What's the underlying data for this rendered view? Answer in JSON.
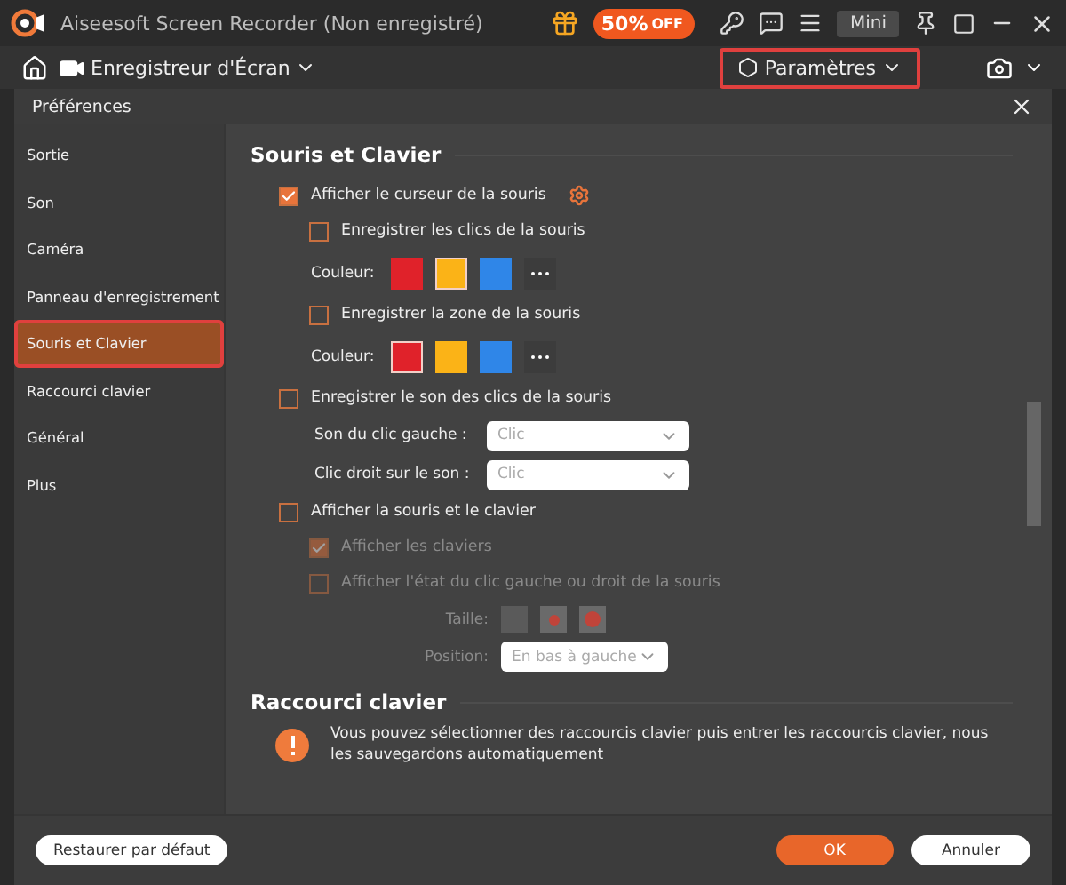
{
  "title_bar": {
    "title": "Aiseesoft Screen Recorder (Non enregistré)",
    "promo": {
      "amount": "50%",
      "suffix": "OFF"
    },
    "mini_button": "Mini"
  },
  "toolbar": {
    "mode": "Enregistreur d'Écran",
    "settings": {
      "label": "Paramètres",
      "highlighted": true
    }
  },
  "dialog": {
    "title": "Préférences",
    "sidebar": [
      {
        "label": "Sortie",
        "selected": false,
        "highlighted": false
      },
      {
        "label": "Son",
        "selected": false,
        "highlighted": false
      },
      {
        "label": "Caméra",
        "selected": false,
        "highlighted": false
      },
      {
        "label": "Panneau d'enregistrement",
        "selected": false,
        "highlighted": false
      },
      {
        "label": "Souris et Clavier",
        "selected": true,
        "highlighted": true
      },
      {
        "label": "Raccourci clavier",
        "selected": false,
        "highlighted": false
      },
      {
        "label": "Général",
        "selected": false,
        "highlighted": false
      },
      {
        "label": "Plus",
        "selected": false,
        "highlighted": false
      }
    ],
    "sections": [
      {
        "title": "Souris et Clavier",
        "options": [
          {
            "label": "Afficher le curseur de la souris",
            "checked": true,
            "disabled": false,
            "settings": true,
            "children": [
              {
                "label": "Enregistrer les clics de la souris",
                "checked": false,
                "disabled": false,
                "colors": {
                  "label": "Couleur:",
                  "swatches": [
                    {
                      "color": "#e0222a",
                      "selected": false
                    },
                    {
                      "color": "#fbb317",
                      "selected": true
                    },
                    {
                      "color": "#2f86e8",
                      "selected": false
                    }
                  ]
                }
              },
              {
                "label": "Enregistrer la zone de la souris",
                "checked": false,
                "disabled": false,
                "colors": {
                  "label": "Couleur:",
                  "swatches": [
                    {
                      "color": "#e0222a",
                      "selected": true
                    },
                    {
                      "color": "#fbb317",
                      "selected": false
                    },
                    {
                      "color": "#2f86e8",
                      "selected": false
                    }
                  ]
                }
              }
            ]
          },
          {
            "label": "Enregistrer le son des clics de la souris",
            "checked": false,
            "disabled": false,
            "selects": [
              {
                "label": "Son du clic gauche :",
                "value": "Clic"
              },
              {
                "label": "Clic droit sur le son :",
                "value": "Clic"
              }
            ]
          },
          {
            "label": "Afficher la souris et le clavier",
            "checked": false,
            "disabled": false,
            "children": [
              {
                "label": "Afficher les claviers",
                "checked": true,
                "disabled": true
              },
              {
                "label": "Afficher l'état du clic gauche ou droit de la souris",
                "checked": false,
                "disabled": true,
                "size": {
                  "label": "Taille:"
                },
                "position": {
                  "label": "Position:",
                  "value": "En bas à gauche"
                }
              }
            ]
          }
        ]
      },
      {
        "title": "Raccourci clavier",
        "info": "Vous pouvez sélectionner des raccourcis clavier puis entrer les raccourcis clavier, nous les sauvegardons automatiquement"
      }
    ],
    "footer": {
      "restore": "Restaurer par défaut",
      "ok": "OK",
      "cancel": "Annuler"
    }
  }
}
